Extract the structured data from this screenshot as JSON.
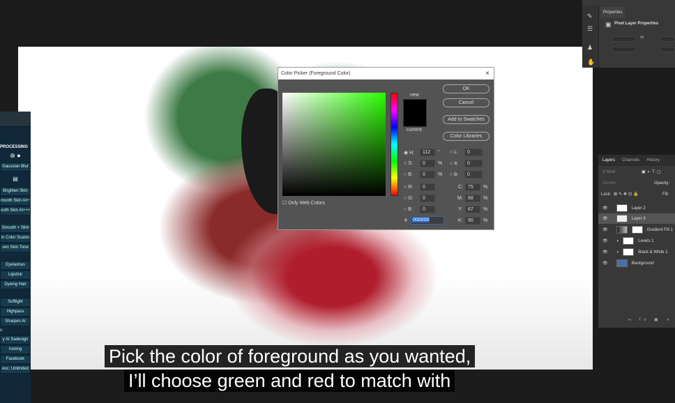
{
  "dialog": {
    "title": "Color Picker (Foreground Color)",
    "close": "×",
    "new_label": "new",
    "current_label": "current",
    "ok": "OK",
    "cancel": "Cancel",
    "add_swatches": "Add to Swatches",
    "color_libraries": "Color Libraries",
    "only_web": "Only Web Colors",
    "hsb": [
      {
        "label": "H:",
        "value": "112",
        "unit": "°"
      },
      {
        "label": "S:",
        "value": "0",
        "unit": "%"
      },
      {
        "label": "B:",
        "value": "0",
        "unit": "%"
      }
    ],
    "rgb": [
      {
        "label": "R:",
        "value": "0"
      },
      {
        "label": "G:",
        "value": "0"
      },
      {
        "label": "B:",
        "value": "0"
      }
    ],
    "lab": [
      {
        "label": "L:",
        "value": "0"
      },
      {
        "label": "a:",
        "value": "0"
      },
      {
        "label": "b:",
        "value": "0"
      }
    ],
    "cmyk": [
      {
        "label": "C:",
        "value": "75",
        "unit": "%"
      },
      {
        "label": "M:",
        "value": "68",
        "unit": "%"
      },
      {
        "label": "Y:",
        "value": "67",
        "unit": "%"
      },
      {
        "label": "K:",
        "value": "90",
        "unit": "%"
      }
    ],
    "hex_label": "#",
    "hex": "000000"
  },
  "left_panel": {
    "heading": "PROCESSING",
    "buttons": [
      "Gaussian Blur",
      "Brighten Skin",
      "mooth Skin AI++",
      "ooth Skin AI+++",
      "Smooth + Slim",
      "in Color Scales",
      "ven Skin Tone",
      "Eyelashes",
      "Lipstick",
      "Dyeing Hair",
      "Softlight",
      "Highpass",
      "Sharpen AI",
      "y AI Sadesign",
      "Ironing",
      "Facebook",
      "esc: Unlimited"
    ],
    "label_c": "c:"
  },
  "properties": {
    "tab": "Properties",
    "title": "Pixel Layer Properties"
  },
  "layers": {
    "tabs": [
      "Layers",
      "Channels",
      "History"
    ],
    "kind": "Kind",
    "blend": "Screen",
    "opacity": "Opacity:",
    "lock": "Lock:",
    "fill": "Fill:",
    "items": [
      {
        "name": "Layer 2"
      },
      {
        "name": "Layer 3"
      },
      {
        "name": "Gradient Fill 1"
      },
      {
        "name": "Levels 1"
      },
      {
        "name": "Black & White 1"
      },
      {
        "name": "Background"
      }
    ]
  },
  "subtitles": [
    "Pick the color of foreground as you wanted,",
    "I’ll choose green and red to match with"
  ]
}
